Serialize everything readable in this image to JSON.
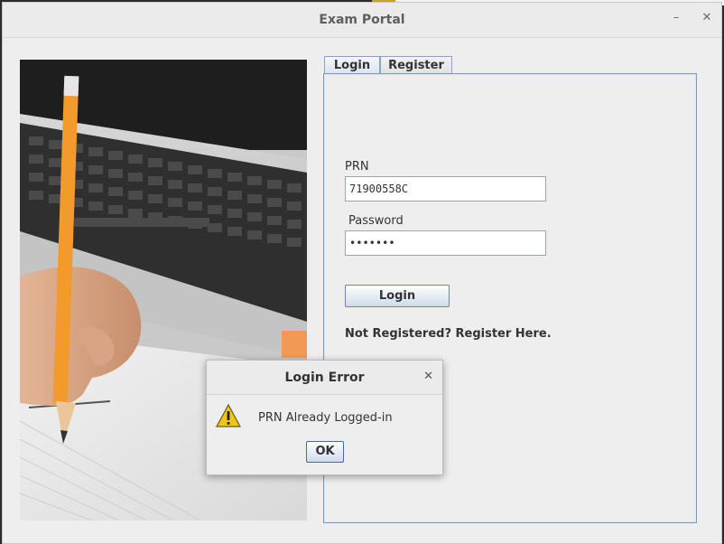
{
  "window": {
    "title": "Exam Portal",
    "minimize_icon": "minimize-icon",
    "close_icon": "close-icon"
  },
  "image": {
    "description_icon": "photo-hand-writing-with-pencil-laptop"
  },
  "tabs": [
    {
      "label": "Login",
      "active": true
    },
    {
      "label": "Register",
      "active": false
    }
  ],
  "login_form": {
    "prn_label": "PRN",
    "prn_value": "71900558C",
    "password_label": "Password",
    "password_value": "•••••••",
    "login_button": "Login",
    "register_link": "Not Registered? Register Here."
  },
  "dialog": {
    "title": "Login Error",
    "message": "PRN Already Logged-in",
    "ok_button": "OK",
    "icon": "warning-icon"
  },
  "colors": {
    "accent": "#7a9ac4",
    "window_bg": "#eeeeee",
    "warning": "#f2c51a"
  }
}
